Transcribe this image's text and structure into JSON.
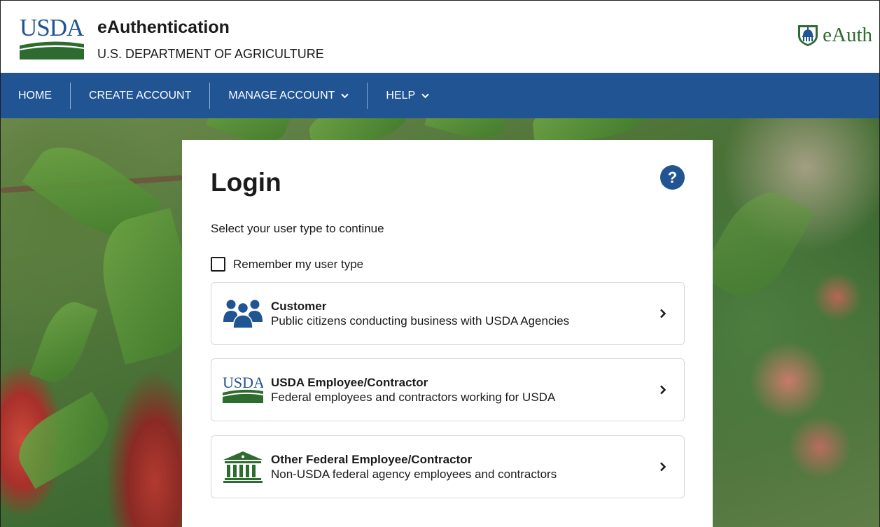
{
  "header": {
    "logo_text": "USDA",
    "title": "eAuthentication",
    "subtitle": "U.S. DEPARTMENT OF AGRICULTURE",
    "eauth_logo_text": "eAuth"
  },
  "nav": {
    "items": [
      {
        "label": "HOME",
        "dropdown": false
      },
      {
        "label": "CREATE ACCOUNT",
        "dropdown": false
      },
      {
        "label": "MANAGE ACCOUNT",
        "dropdown": true
      },
      {
        "label": "HELP",
        "dropdown": true
      }
    ]
  },
  "login": {
    "title": "Login",
    "help_icon": "?",
    "instruction": "Select your user type to continue",
    "remember_label": "Remember my user type",
    "remember_checked": false,
    "options": [
      {
        "icon": "people-group-icon",
        "title": "Customer",
        "description": "Public citizens conducting business with USDA Agencies"
      },
      {
        "icon": "usda-logo-icon",
        "icon_text": "USDA",
        "title": "USDA Employee/Contractor",
        "description": "Federal employees and contractors working for USDA"
      },
      {
        "icon": "federal-building-icon",
        "title": "Other Federal Employee/Contractor",
        "description": "Non-USDA federal agency employees and contractors"
      }
    ]
  },
  "colors": {
    "nav_blue": "#205493",
    "usda_green": "#2e6b2f",
    "text": "#1b1b1b",
    "border": "#d6d7d9"
  }
}
